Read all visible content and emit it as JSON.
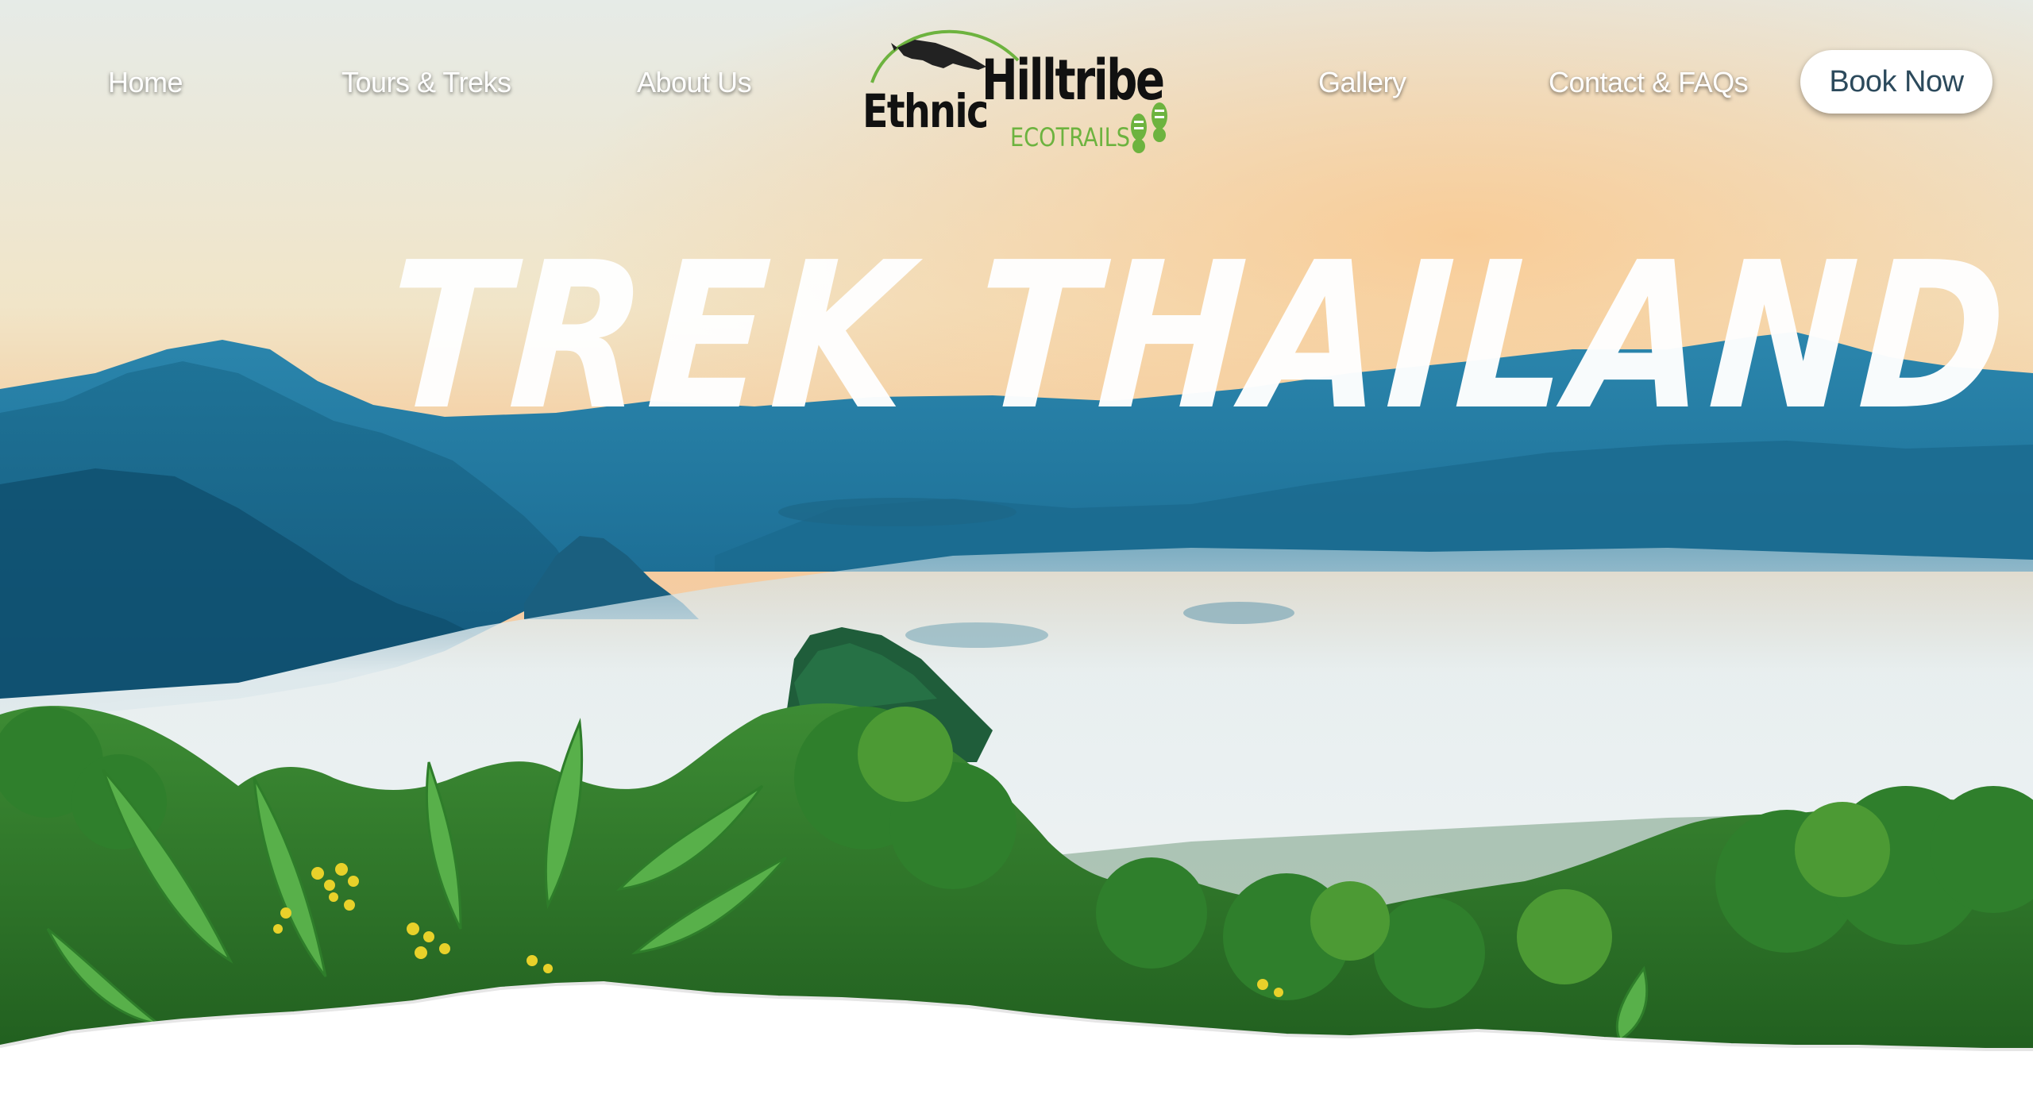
{
  "nav": {
    "home": "Home",
    "tours": "Tours & Treks",
    "about": "About Us",
    "gallery": "Gallery",
    "contact": "Contact & FAQs",
    "book": "Book Now"
  },
  "logo": {
    "word1": "Ethnic",
    "word2": "Hilltribe",
    "word3": "ECOTRAILS",
    "icon": "hornbill-bird-icon",
    "footprints_icon": "boot-prints-icon"
  },
  "hero": {
    "headline": "Trek Thailand",
    "image": "misty-mountain-valley-jungle-photo"
  },
  "colors": {
    "button_text": "#2c4a5c",
    "logo_green": "#6db33f",
    "sky_top": "#e9ece6",
    "sky_horizon": "#f6c48e",
    "mountain_blue": "#1f7aa3",
    "jungle_green": "#2f7a2a"
  }
}
